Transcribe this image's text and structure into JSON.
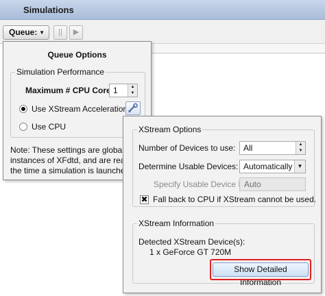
{
  "window": {
    "title": "Simulations"
  },
  "toolbar": {
    "queue_label": "Queue:",
    "queue_arrow": "▼",
    "pause_label": "||",
    "play_label": "▶"
  },
  "queue_options": {
    "title": "Queue Options",
    "performance_group": "Simulation Performance",
    "max_cores_label": "Maximum # CPU Cores:",
    "max_cores_value": "1",
    "use_xstream_label": "Use XStream Acceleration",
    "use_cpu_label": "Use CPU",
    "note_lines": [
      "Note: These settings are global acr",
      "instances of XFdtd, and are read at",
      "the time a simulation is launched."
    ]
  },
  "xstream_options": {
    "group_title": "XStream Options",
    "num_devices_label": "Number of Devices to use:",
    "num_devices_value": "All",
    "usable_devices_label": "Determine Usable Devices:",
    "usable_devices_value": "Automatically",
    "device_ids_label": "Specify Usable Device IDs:",
    "device_ids_value": "Auto",
    "fallback_label": "Fall back to CPU if XStream cannot be used.",
    "fallback_checked_mark": "✖",
    "info_group_title": "XStream Information",
    "detected_label": "Detected XStream Device(s):",
    "detected_device": "1 x GeForce GT 720M",
    "details_button": "Show Detailed Information"
  },
  "colors": {
    "titlebar": "#a9bcd9",
    "highlight": "#e02020"
  }
}
